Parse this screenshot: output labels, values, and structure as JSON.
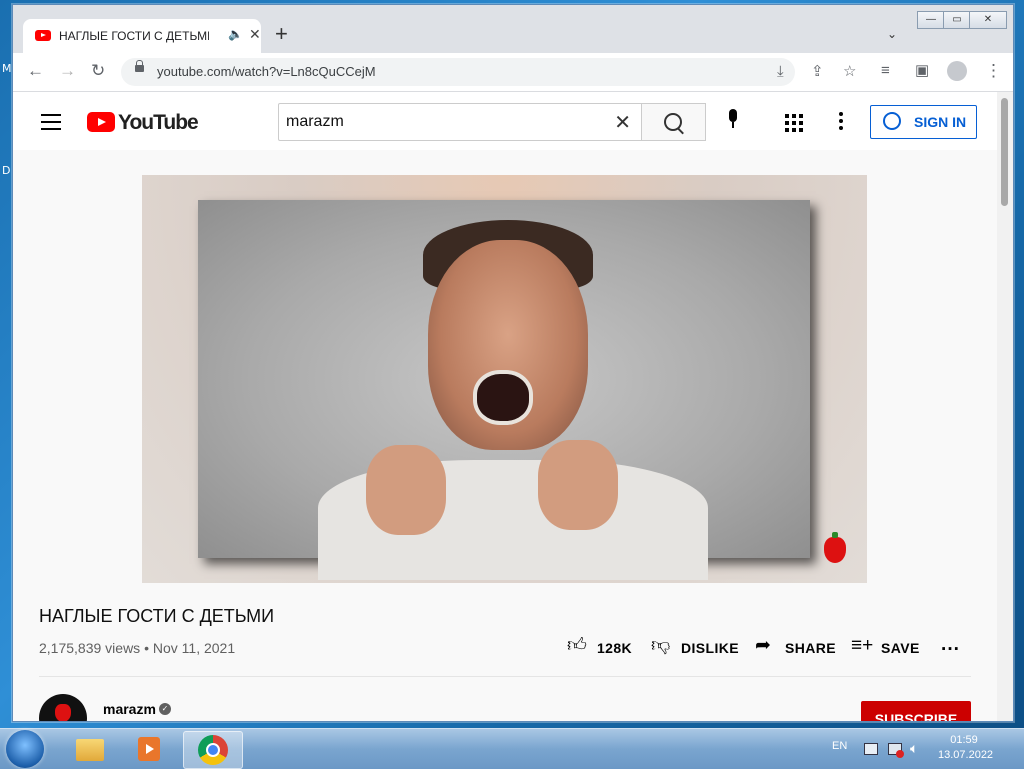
{
  "desktop": {
    "left_text_1": "M",
    "left_text_2": "D"
  },
  "browser": {
    "tab_title": "НАГЛЫЕ ГОСТИ С ДЕТЬМИ",
    "url": "youtube.com/watch?v=Ln8cQuCCejM"
  },
  "youtube": {
    "logo_text": "YouTube",
    "search_value": "marazm",
    "sign_in_label": "SIGN IN",
    "video_title": "НАГЛЫЕ ГОСТИ С ДЕТЬМИ",
    "views": "2,175,839 views",
    "date": "Nov 11, 2021",
    "likes": "128K",
    "dislike_label": "DISLIKE",
    "share_label": "SHARE",
    "save_label": "SAVE",
    "channel_name": "marazm",
    "subscribe_label": "SUBSCRIBE"
  },
  "taskbar": {
    "language": "EN",
    "time": "01:59",
    "date": "13.07.2022"
  }
}
